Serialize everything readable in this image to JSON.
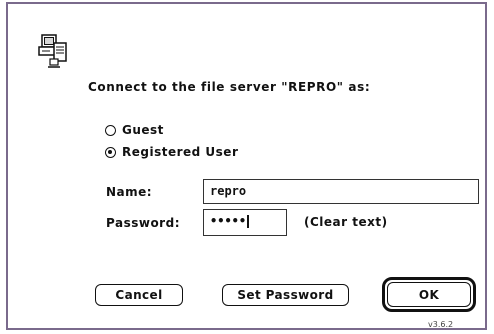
{
  "dialog": {
    "title": "Connect to the file server \"REPRO\" as:",
    "icon": "file-server-icon",
    "options": {
      "guest_label": "Guest",
      "registered_label": "Registered User",
      "selected": "Registered User"
    },
    "name_label": "Name:",
    "name_value": "repro",
    "password_label": "Password:",
    "password_value": "•••••",
    "clear_text_label": "(Clear text)",
    "buttons": {
      "cancel": "Cancel",
      "set_password": "Set Password",
      "ok": "OK"
    },
    "version": "v3.6.2"
  }
}
